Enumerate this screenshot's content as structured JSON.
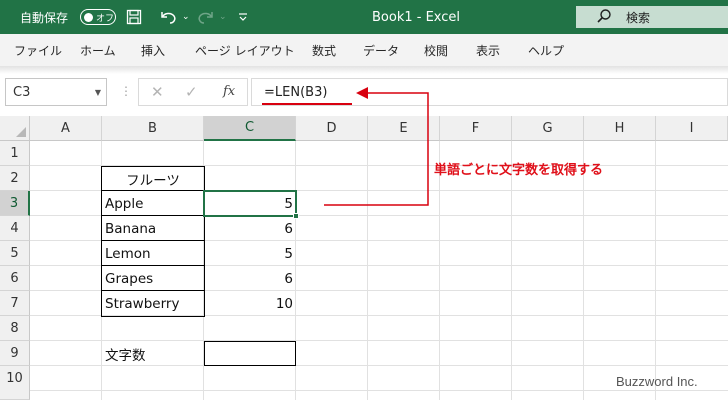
{
  "titlebar": {
    "autosave_label": "自動保存",
    "autosave_state": "オフ",
    "save_icon": "save-icon",
    "document_title": "Book1  -  Excel",
    "search_placeholder": "検索",
    "color": "#217346"
  },
  "ribbon": {
    "tabs": [
      {
        "label": "ファイル"
      },
      {
        "label": "ホーム"
      },
      {
        "label": "挿入"
      },
      {
        "label": "ページ レイアウト"
      },
      {
        "label": "数式"
      },
      {
        "label": "データ"
      },
      {
        "label": "校閲"
      },
      {
        "label": "表示"
      },
      {
        "label": "ヘルプ"
      }
    ]
  },
  "formula_bar": {
    "name_box": "C3",
    "fx_label": "fx",
    "formula": "=LEN(B3)"
  },
  "sheet": {
    "columns": [
      "A",
      "B",
      "C",
      "D",
      "E",
      "F",
      "G",
      "H",
      "I"
    ],
    "rows": [
      "1",
      "2",
      "3",
      "4",
      "5",
      "6",
      "7",
      "8",
      "9",
      "10"
    ],
    "selected_cell": "C3",
    "header_b2": "フルーツ",
    "fruits": [
      {
        "name": "Apple",
        "length": "5"
      },
      {
        "name": "Banana",
        "length": "6"
      },
      {
        "name": "Lemon",
        "length": "5"
      },
      {
        "name": "Grapes",
        "length": "6"
      },
      {
        "name": "Strawberry",
        "length": "10"
      }
    ],
    "label_b9": "文字数",
    "value_c9": ""
  },
  "annotation": {
    "text": "単語ごとに文字数を取得する",
    "color": "#e0101a"
  },
  "watermark": "Buzzword Inc."
}
